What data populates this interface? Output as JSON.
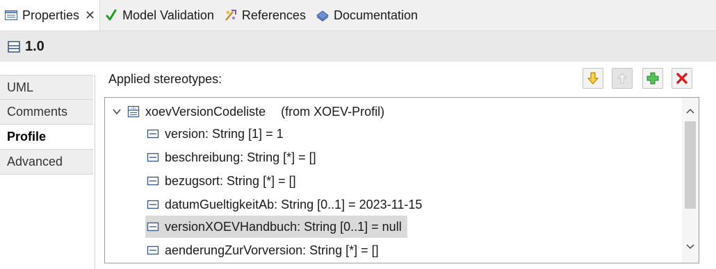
{
  "tabs": [
    {
      "label": "Properties",
      "icon": "properties-icon",
      "active": true,
      "closable": true
    },
    {
      "label": "Model Validation",
      "icon": "checkmark-icon"
    },
    {
      "label": "References",
      "icon": "references-icon"
    },
    {
      "label": "Documentation",
      "icon": "documentation-icon"
    }
  ],
  "header": {
    "title": "1.0",
    "icon": "package-icon"
  },
  "sections": [
    "UML",
    "Comments",
    "Profile",
    "Advanced"
  ],
  "active_section": "Profile",
  "stereotypes": {
    "label": "Applied stereotypes:",
    "buttons": [
      {
        "name": "move-down",
        "icon": "arrow-down-icon",
        "enabled": true
      },
      {
        "name": "move-up",
        "icon": "arrow-up-icon",
        "enabled": false
      },
      {
        "name": "add",
        "icon": "plus-icon",
        "enabled": true
      },
      {
        "name": "remove",
        "icon": "delete-icon",
        "enabled": true
      }
    ],
    "tree": {
      "root": {
        "name": "xoevVersionCodeliste",
        "source": "(from XOEV-Profil)",
        "expanded": true,
        "icon": "stereotype-icon"
      },
      "attributes": [
        "version: String [1] = 1",
        "beschreibung: String [*] = []",
        "bezugsort: String [*] = []",
        "datumGueltigkeitAb: String [0..1] = 2023-11-15",
        "versionXOEVHandbuch: String [0..1] = null",
        "aenderungZurVorversion: String [*] = []"
      ],
      "selected_index": 4,
      "attribute_icon": "property-icon"
    }
  },
  "colors": {
    "check": "#1e9e1e",
    "down_arrow": "#e0a800",
    "add": "#2e9e2e",
    "remove": "#d42020",
    "selection": "#dadada"
  }
}
